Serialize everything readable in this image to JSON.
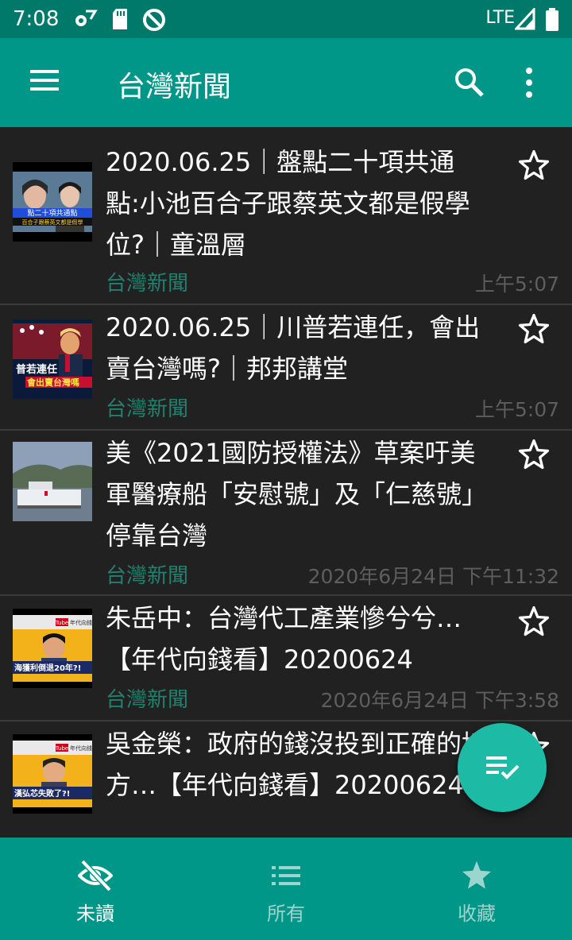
{
  "status_bar": {
    "time": "7:08",
    "network": "LTE"
  },
  "app_bar": {
    "title": "台灣新聞",
    "icons": [
      "menu-icon",
      "search-icon",
      "more-vert-icon"
    ]
  },
  "news_items": [
    {
      "title": "2020.06.25｜盤點二十項共通點:小池百合子跟蔡英文都是假學位?｜童溫層",
      "source": "台灣新聞",
      "time": "上午5:07"
    },
    {
      "title": "2020.06.25｜川普若連任，會出賣台灣嗎?｜邦邦講堂",
      "source": "台灣新聞",
      "time": "上午5:07"
    },
    {
      "title": "美《2021國防授權法》草案吁美軍醫療船「安慰號」及「仁慈號」停靠台灣",
      "source": "台灣新聞",
      "time": "2020年6月24日 下午11:32"
    },
    {
      "title": "朱岳中：台灣代工產業慘兮兮…【年代向錢看】20200624",
      "source": "台灣新聞",
      "time": "2020年6月24日 下午3:58"
    },
    {
      "title": "吳金榮：政府的錢沒投到正確的地方…【年代向錢看】20200624",
      "source": "",
      "time": ""
    }
  ],
  "thumbnails": {
    "t1": {
      "line1": "點二十項共通點",
      "line2": "百合子跟蔡英文都是假學"
    },
    "t2": {
      "line1": "普若連任",
      "line2": "會出賣台灣嗎"
    },
    "t4": {
      "badge": "Tube",
      "channel": "年代向錢",
      "line": "海獲利倒退20年?!"
    },
    "t5": {
      "badge": "Tube",
      "channel": "年代向錢",
      "line": "漢弘芯失敗了?!"
    }
  },
  "bottom_nav": [
    {
      "label": "未讀",
      "icon": "visibility-off-icon",
      "active": true
    },
    {
      "label": "所有",
      "icon": "list-icon",
      "active": false
    },
    {
      "label": "收藏",
      "icon": "star-icon",
      "active": false
    }
  ],
  "colors": {
    "status_bar": "#00796b",
    "primary": "#009688",
    "fab": "#1dbaa6",
    "background": "#212121",
    "source_text": "#23806f",
    "time_text": "#5e5e5e"
  }
}
